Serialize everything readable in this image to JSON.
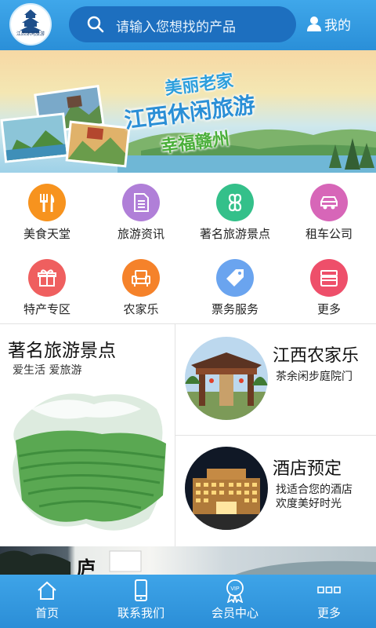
{
  "header": {
    "logo_text": "江西休闲旅游",
    "search_placeholder": "请输入您想找的产品",
    "search_icon": "search-icon",
    "me_label": "我的",
    "me_icon": "user-icon"
  },
  "banner": {
    "line1": "美丽老家",
    "line2": "江西休闲旅游",
    "line3": "幸福赣州"
  },
  "categories": [
    {
      "label": "美食天堂",
      "icon": "fork-knife-icon",
      "color": "#f7931e"
    },
    {
      "label": "旅游资讯",
      "icon": "document-icon",
      "color": "#b07fd8"
    },
    {
      "label": "著名旅游景点",
      "icon": "clover-icon",
      "color": "#34c08a"
    },
    {
      "label": "租车公司",
      "icon": "car-icon",
      "color": "#d766b8"
    },
    {
      "label": "特产专区",
      "icon": "gift-icon",
      "color": "#ef5f5f"
    },
    {
      "label": "农家乐",
      "icon": "sofa-icon",
      "color": "#f5822a"
    },
    {
      "label": "票务服务",
      "icon": "tag-icon",
      "color": "#6aa4ef"
    },
    {
      "label": "更多",
      "icon": "layers-icon",
      "color": "#ee4f6a"
    }
  ],
  "cards": {
    "left": {
      "title": "著名旅游景点",
      "subtitle": "爱生活 爱旅游"
    },
    "right": [
      {
        "title": "江西农家乐",
        "subtitle_lines": [
          "茶余闲步庭院门"
        ]
      },
      {
        "title": "酒店预定",
        "subtitle_lines": [
          "找适合您的酒店",
          "欢度美好时光"
        ]
      }
    ]
  },
  "strip": {
    "text": "庐"
  },
  "nav": [
    {
      "label": "首页",
      "icon": "home-icon"
    },
    {
      "label": "联系我们",
      "icon": "phone-icon"
    },
    {
      "label": "会员中心",
      "icon": "vip-badge-icon",
      "badge_text": "VIP"
    },
    {
      "label": "更多",
      "icon": "more-icon"
    }
  ]
}
